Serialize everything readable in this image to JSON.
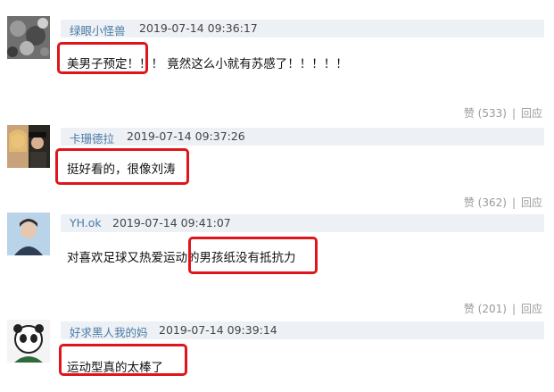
{
  "comments": [
    {
      "username": "绿眼小怪兽",
      "time": "2019-07-14 09:36:17",
      "text": "美男子预定！！！ 竟然这么小就有苏感了！！！！！",
      "likes": "赞 (533)",
      "reply": "回应",
      "avatar": "gray-texture-avatar"
    },
    {
      "username": "卡珊德拉",
      "time": "2019-07-14 09:37:26",
      "text": "挺好看的，很像刘涛",
      "likes": "赞 (362)",
      "reply": "回应",
      "avatar": "couple-photo-avatar"
    },
    {
      "username": "YH.ok",
      "time": "2019-07-14 09:41:07",
      "text": "对喜欢足球又热爱运动的男孩纸没有抵抗力",
      "likes": "赞 (201)",
      "reply": "回应",
      "avatar": "person-sky-avatar"
    },
    {
      "username": "好求黑人我的妈",
      "time": "2019-07-14 09:39:14",
      "text": "运动型真的太棒了",
      "likes": "",
      "reply": "",
      "avatar": "panda-cartoon-avatar"
    }
  ],
  "colors": {
    "highlight": "#e0151b",
    "username": "#4a7aa5",
    "header_bg": "#edf1f5"
  }
}
